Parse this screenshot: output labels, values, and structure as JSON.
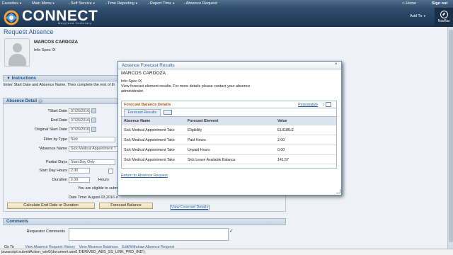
{
  "topnav": {
    "favorites": "Favorites",
    "main_menu": "Main Menu",
    "crumbs": [
      "Self Service",
      "Time Reporting",
      "Report Time",
      "Absence Request"
    ],
    "home": "Home",
    "signout": "Sign out"
  },
  "banner": {
    "logo": "CONNECT",
    "logo_sub": "Maryland Judiciary",
    "add_to": "Add To",
    "navbar": "NavBar"
  },
  "page": {
    "title": "Request Absence",
    "employee_name": "MARCOS CARDOZA",
    "job_title": "Info Spec IX",
    "instructions_header": "Instructions",
    "instructions_text": "Enter Start Date and Absence Name. Then complete the rest of th",
    "absence_detail_header": "Absence Detail",
    "fields": {
      "start_date_label": "*Start Date",
      "start_date": "07/26/2016",
      "end_date_label": "End Date",
      "end_date": "07/26/2016",
      "orig_start_label": "Original Start Date",
      "orig_start": "07/26/2016",
      "filter_label": "Filter by Type",
      "filter": "Sick",
      "absence_name_label": "*Absence Name",
      "absence_name": "Sick Medical Appointment T",
      "partial_label": "Partial Days",
      "partial": "Start Day Only",
      "start_hours_label": "Start Day Hours",
      "start_hours": "2.00",
      "duration_label": "Duration",
      "duration": "2.00",
      "duration_unit": "Hours",
      "eligible_text": "You are eligible to submit this",
      "datetime": "Date Time: August 03,2016 at 11:10"
    },
    "buttons": {
      "calc": "Calculate End Date or Duration",
      "forecast": "Forecast Balance",
      "view_forecast": "View Forecast Details"
    },
    "comments_header": "Comments",
    "requestor_comments_label": "Requestor Comments",
    "bottom_links": [
      "Go To",
      "View Absence Request History",
      "View Absence Balances",
      "Edit/Withdraw Absence Request"
    ]
  },
  "modal": {
    "title": "Absence Forecast Results",
    "close": "×",
    "employee_name": "MARCOS CARDOZA",
    "job_title": "Info Spec IX",
    "message": "View forecast element results. For more details please contact your absence administrator.",
    "grid_title": "Forecast Balance Details",
    "personalize": "Personalize",
    "tab": "Forecast Results",
    "columns": [
      "Absence Name",
      "Forecast Element",
      "Value"
    ],
    "rows": [
      [
        "Sick Medical Appointment Take",
        "Eligibility",
        "ELIGIBLE"
      ],
      [
        "Sick Medical Appointment Take",
        "Paid Hours",
        "2.00"
      ],
      [
        "Sick Medical Appointment Take",
        "Unpaid Hours",
        "0.00"
      ],
      [
        "Sick Medical Appointment Take",
        "Sick Leave Available Balance",
        "141.57"
      ]
    ],
    "return_link": "Return to Absence Request"
  },
  "status_bar": "javascript:submitAction_win0(document.win0,'DERIVED_ABS_SS_LINK_PRD_IND');"
}
